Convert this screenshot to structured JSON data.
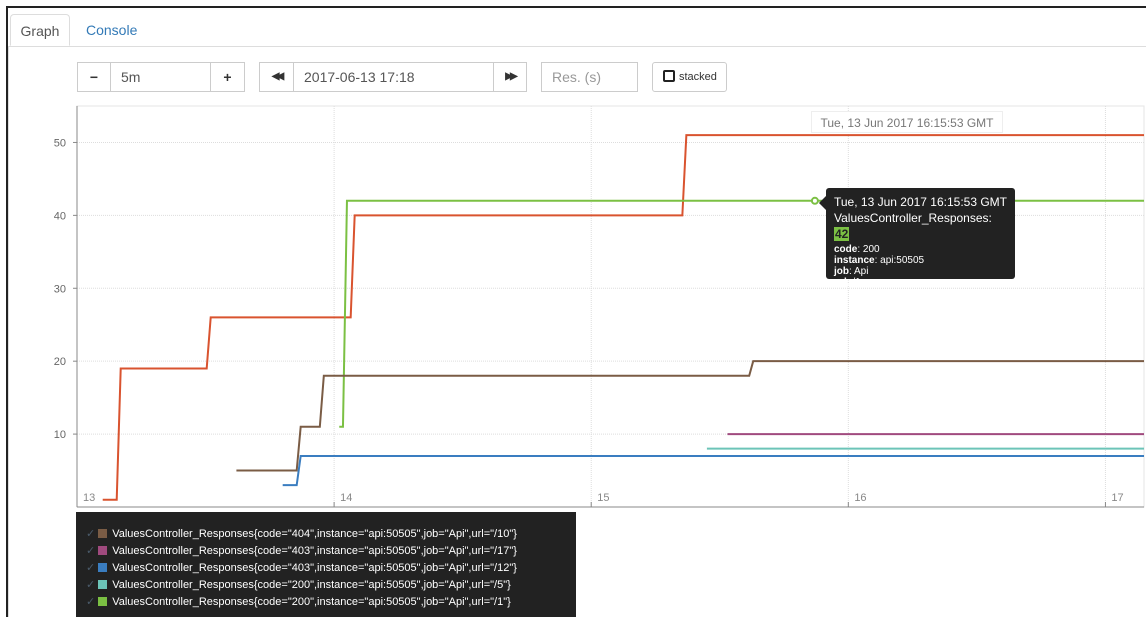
{
  "tabs": [
    {
      "label": "Graph",
      "active": true
    },
    {
      "label": "Console",
      "active": false
    }
  ],
  "controls": {
    "range_minus": "−",
    "range_value": "5m",
    "range_plus": "+",
    "end_back": "◀◀",
    "end_time": "2017-06-13 17:18",
    "end_forward": "▶▶",
    "resolution_placeholder": "Res. (s)",
    "stacked_label": "stacked"
  },
  "hover_time": "Tue, 13 Jun 2017 16:15:53 GMT",
  "tooltip": {
    "time": "Tue, 13 Jun 2017 16:15:53 GMT",
    "metric": "ValuesController_Responses:",
    "value": "42",
    "labels": [
      {
        "key": "code",
        "value": "200"
      },
      {
        "key": "instance",
        "value": "api:50505"
      },
      {
        "key": "job",
        "value": "Api"
      },
      {
        "key": "url",
        "value": "/1"
      }
    ]
  },
  "legend": [
    {
      "label": "ValuesController_Responses{code=\"404\",instance=\"api:50505\",job=\"Api\",url=\"/10\"}",
      "color": "#7a5c45"
    },
    {
      "label": "ValuesController_Responses{code=\"403\",instance=\"api:50505\",job=\"Api\",url=\"/17\"}",
      "color": "#a04a7e"
    },
    {
      "label": "ValuesController_Responses{code=\"403\",instance=\"api:50505\",job=\"Api\",url=\"/12\"}",
      "color": "#3a7dc0"
    },
    {
      "label": "ValuesController_Responses{code=\"200\",instance=\"api:50505\",job=\"Api\",url=\"/5\"}",
      "color": "#6cc4b8"
    },
    {
      "label": "ValuesController_Responses{code=\"200\",instance=\"api:50505\",job=\"Api\",url=\"/1\"}",
      "color": "#7bc043"
    }
  ],
  "chart_data": {
    "type": "line",
    "x_ticks": [
      "13",
      "14",
      "15",
      "16",
      "17"
    ],
    "x_tick_values": [
      13,
      14,
      15,
      16,
      17
    ],
    "y_ticks": [
      "10",
      "20",
      "30",
      "40",
      "50"
    ],
    "y_tick_values": [
      10,
      20,
      30,
      40,
      50
    ],
    "xlim": [
      13,
      17.15
    ],
    "ylim": [
      0,
      55
    ],
    "grid": true,
    "series": [
      {
        "color": "#d9532f",
        "step": true,
        "x": [
          13.1,
          13.17,
          13.52,
          14.08,
          15.37,
          17.15
        ],
        "y": [
          1,
          19,
          26,
          40,
          51,
          51
        ]
      },
      {
        "color": "#7bc043",
        "step": true,
        "x": [
          14.02,
          14.05,
          17.15
        ],
        "y": [
          11,
          42,
          42
        ]
      },
      {
        "color": "#7a5c45",
        "step": true,
        "x": [
          13.62,
          13.87,
          13.96,
          15.63,
          17.15
        ],
        "y": [
          5,
          11,
          18,
          20,
          20
        ]
      },
      {
        "color": "#a04a7e",
        "step": true,
        "x": [
          15.53,
          17.15
        ],
        "y": [
          10,
          10
        ]
      },
      {
        "color": "#3a7dc0",
        "step": true,
        "x": [
          13.8,
          13.87,
          17.15
        ],
        "y": [
          3,
          7,
          7
        ]
      },
      {
        "color": "#6cc4b8",
        "step": true,
        "x": [
          15.45,
          17.15
        ],
        "y": [
          8,
          8
        ]
      }
    ],
    "hover_point": {
      "x": 15.87,
      "y": 42
    }
  }
}
